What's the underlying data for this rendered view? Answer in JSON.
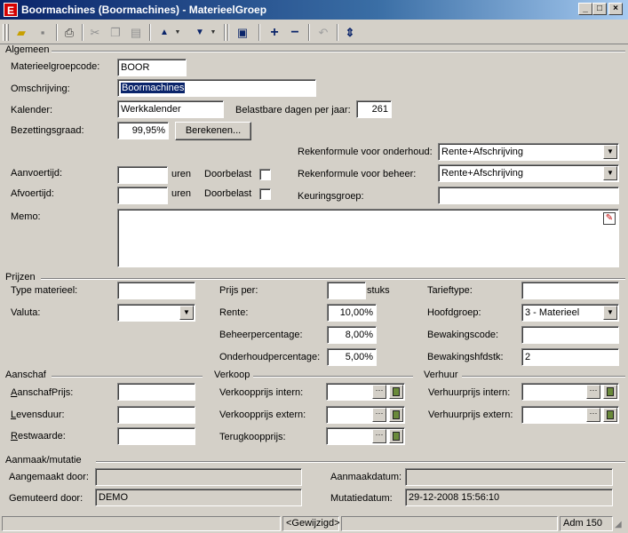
{
  "window": {
    "title": "Boormachines (Boormachines) - MaterieelGroep",
    "app_icon": "E",
    "minimize_icon": "_",
    "maximize_icon": "□",
    "close_icon": "×"
  },
  "toolbar": {
    "icons": [
      "open-folder-icon",
      "save-icon",
      "print-icon",
      "cut-icon",
      "copy-icon",
      "paste-icon",
      "arrow-up-icon",
      "arrow-down-icon",
      "layout-icon",
      "add-icon",
      "remove-icon",
      "undo-icon",
      "refresh-icon"
    ]
  },
  "algemeen": {
    "section": "Algemeen",
    "code_label": "Materieelgroepcode:",
    "code_value": "BOOR",
    "omschrijving_label": "Omschrijving:",
    "omschrijving_value": "Boormachines",
    "kalender_label": "Kalender:",
    "kalender_value": "Werkkalender",
    "belastbare_label": "Belastbare dagen per jaar:",
    "belastbare_value": "261",
    "bezetting_label": "Bezettingsgraad:",
    "bezetting_value": "99,95%",
    "bereken_button": "Berekenen...",
    "reken_onderhoud_label": "Rekenformule voor onderhoud:",
    "reken_onderhoud_value": "Rente+Afschrijving",
    "reken_beheer_label": "Rekenformule voor beheer:",
    "reken_beheer_value": "Rente+Afschrijving",
    "aanvoertijd_label": "Aanvoertijd:",
    "afvoertijd_label": "Afvoertijd:",
    "uren": "uren",
    "doorbelast": "Doorbelast",
    "keuringsgroep_label": "Keuringsgroep:",
    "memo_label": "Memo:"
  },
  "prijzen": {
    "section": "Prijzen",
    "type_label": "Type materieel:",
    "valuta_label": "Valuta:",
    "prijs_per_label": "Prijs per:",
    "stuks": "stuks",
    "rente_label": "Rente:",
    "rente_value": "10,00%",
    "beheer_label": "Beheerpercentage:",
    "beheer_value": "8,00%",
    "onderhoud_label": "Onderhoudpercentage:",
    "onderhoud_value": "5,00%",
    "tarieftype_label": "Tarieftype:",
    "hoofdgroep_label": "Hoofdgroep:",
    "hoofdgroep_value": "3 - Materieel",
    "bewakingscode_label": "Bewakingscode:",
    "bewakingshfdstk_label": "Bewakingshfdstk:",
    "bewakingshfdstk_value": "2"
  },
  "aanschaf": {
    "section": "Aanschaf",
    "prijs_label_u": "A",
    "prijs_label": "anschafPrijs:",
    "levensduur_u": "L",
    "levensduur_label": "evensduur:",
    "restwaarde_u": "R",
    "restwaarde_label": "estwaarde:"
  },
  "verkoop": {
    "section": "Verkoop",
    "intern_label": "Verkoopprijs intern:",
    "extern_label": "Verkoopprijs extern:",
    "terug_label": "Terugkoopprijs:"
  },
  "verhuur": {
    "section": "Verhuur",
    "intern_label": "Verhuurprijs intern:",
    "extern_label": "Verhuurprijs extern:"
  },
  "mutatie": {
    "section": "Aanmaak/mutatie",
    "aangemaakt_label": "Aangemaakt door:",
    "aangemaakt_value": "",
    "gemuteerd_label": "Gemuteerd door:",
    "gemuteerd_value": "DEMO",
    "aanmaakdatum_label": "Aanmaakdatum:",
    "aanmaakdatum_value": "",
    "mutatiedatum_label": "Mutatiedatum:",
    "mutatiedatum_value": "29-12-2008 15:56:10"
  },
  "status": {
    "state": "<Gewijzigd>",
    "user": "Adm 150"
  }
}
